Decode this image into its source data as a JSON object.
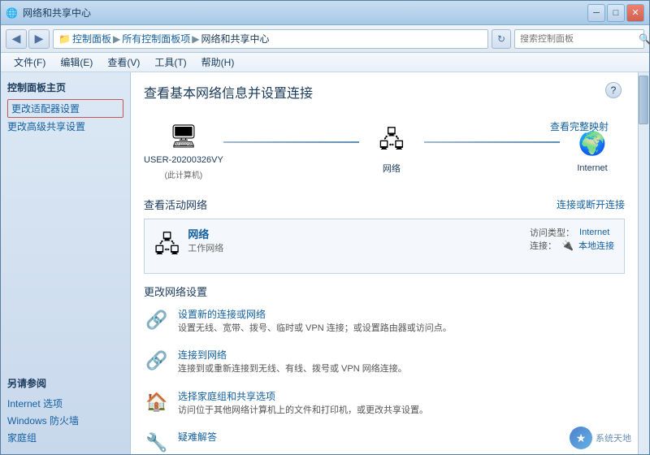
{
  "window": {
    "title": "网络和共享中心",
    "controls": {
      "minimize": "─",
      "maximize": "□",
      "close": "✕"
    }
  },
  "addressBar": {
    "nav_back": "◀",
    "nav_forward": "▶",
    "breadcrumbs": [
      {
        "label": "控制面板",
        "active": false
      },
      {
        "label": "所有控制面板项",
        "active": false
      },
      {
        "label": "网络和共享中心",
        "active": true
      }
    ],
    "refresh": "↻",
    "search_placeholder": "搜索控制面板",
    "search_icon": "🔍"
  },
  "menuBar": {
    "items": [
      {
        "label": "文件(F)"
      },
      {
        "label": "编辑(E)"
      },
      {
        "label": "查看(V)"
      },
      {
        "label": "工具(T)"
      },
      {
        "label": "帮助(H)"
      }
    ]
  },
  "sidebar": {
    "section_title": "控制面板主页",
    "links": [
      {
        "label": "更改适配器设置",
        "highlighted": true
      },
      {
        "label": "更改高级共享设置",
        "highlighted": false
      }
    ],
    "also_section": {
      "title": "另请参阅",
      "links": [
        {
          "label": "Internet 选项"
        },
        {
          "label": "Windows 防火墙"
        },
        {
          "label": "家庭组"
        }
      ]
    }
  },
  "content": {
    "help_icon": "?",
    "page_title": "查看基本网络信息并设置连接",
    "network_diagram": {
      "nodes": [
        {
          "icon": "🖥",
          "label": "USER-20200326VY",
          "sublabel": "(此计算机)"
        },
        {
          "icon": "🌐",
          "label": "网络",
          "sublabel": ""
        },
        {
          "icon": "🌍",
          "label": "Internet",
          "sublabel": ""
        }
      ],
      "view_full_link": "查看完整映射"
    },
    "active_network_section": {
      "title": "查看活动网络",
      "connect_link": "连接或断开连接",
      "network": {
        "icon": "🖧",
        "name": "网络",
        "type": "工作网络",
        "access_type_label": "访问类型：",
        "access_type_value": "Internet",
        "connection_label": "连接：",
        "connection_icon": "🔌",
        "connection_value": "本地连接"
      }
    },
    "change_settings_section": {
      "title": "更改网络设置",
      "items": [
        {
          "icon": "🔗",
          "link": "设置新的连接或网络",
          "desc": "设置无线、宽带、拨号、临时或 VPN 连接；或设置路由器或访问点。"
        },
        {
          "icon": "🔗",
          "link": "连接到网络",
          "desc": "连接到或重新连接到无线、有线、拨号或 VPN 网络连接。"
        },
        {
          "icon": "🏠",
          "link": "选择家庭组和共享选项",
          "desc": "访问位于其他网络计算机上的文件和打印机，或更改共享设置。"
        },
        {
          "icon": "🔧",
          "link": "疑难解答",
          "desc": ""
        }
      ]
    }
  },
  "watermark": {
    "icon": "★",
    "text": "系统天地"
  }
}
